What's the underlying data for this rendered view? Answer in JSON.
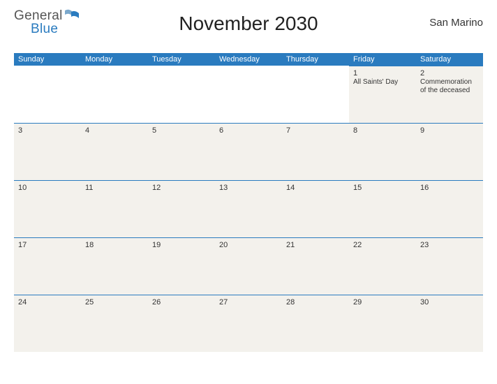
{
  "logo": {
    "text1": "General",
    "text2": "Blue"
  },
  "title": "November 2030",
  "region": "San Marino",
  "day_headers": [
    "Sunday",
    "Monday",
    "Tuesday",
    "Wednesday",
    "Thursday",
    "Friday",
    "Saturday"
  ],
  "weeks": [
    [
      {
        "n": "",
        "e": ""
      },
      {
        "n": "",
        "e": ""
      },
      {
        "n": "",
        "e": ""
      },
      {
        "n": "",
        "e": ""
      },
      {
        "n": "",
        "e": ""
      },
      {
        "n": "1",
        "e": "All Saints' Day"
      },
      {
        "n": "2",
        "e": "Commemoration of the deceased"
      }
    ],
    [
      {
        "n": "3",
        "e": ""
      },
      {
        "n": "4",
        "e": ""
      },
      {
        "n": "5",
        "e": ""
      },
      {
        "n": "6",
        "e": ""
      },
      {
        "n": "7",
        "e": ""
      },
      {
        "n": "8",
        "e": ""
      },
      {
        "n": "9",
        "e": ""
      }
    ],
    [
      {
        "n": "10",
        "e": ""
      },
      {
        "n": "11",
        "e": ""
      },
      {
        "n": "12",
        "e": ""
      },
      {
        "n": "13",
        "e": ""
      },
      {
        "n": "14",
        "e": ""
      },
      {
        "n": "15",
        "e": ""
      },
      {
        "n": "16",
        "e": ""
      }
    ],
    [
      {
        "n": "17",
        "e": ""
      },
      {
        "n": "18",
        "e": ""
      },
      {
        "n": "19",
        "e": ""
      },
      {
        "n": "20",
        "e": ""
      },
      {
        "n": "21",
        "e": ""
      },
      {
        "n": "22",
        "e": ""
      },
      {
        "n": "23",
        "e": ""
      }
    ],
    [
      {
        "n": "24",
        "e": ""
      },
      {
        "n": "25",
        "e": ""
      },
      {
        "n": "26",
        "e": ""
      },
      {
        "n": "27",
        "e": ""
      },
      {
        "n": "28",
        "e": ""
      },
      {
        "n": "29",
        "e": ""
      },
      {
        "n": "30",
        "e": ""
      }
    ]
  ]
}
